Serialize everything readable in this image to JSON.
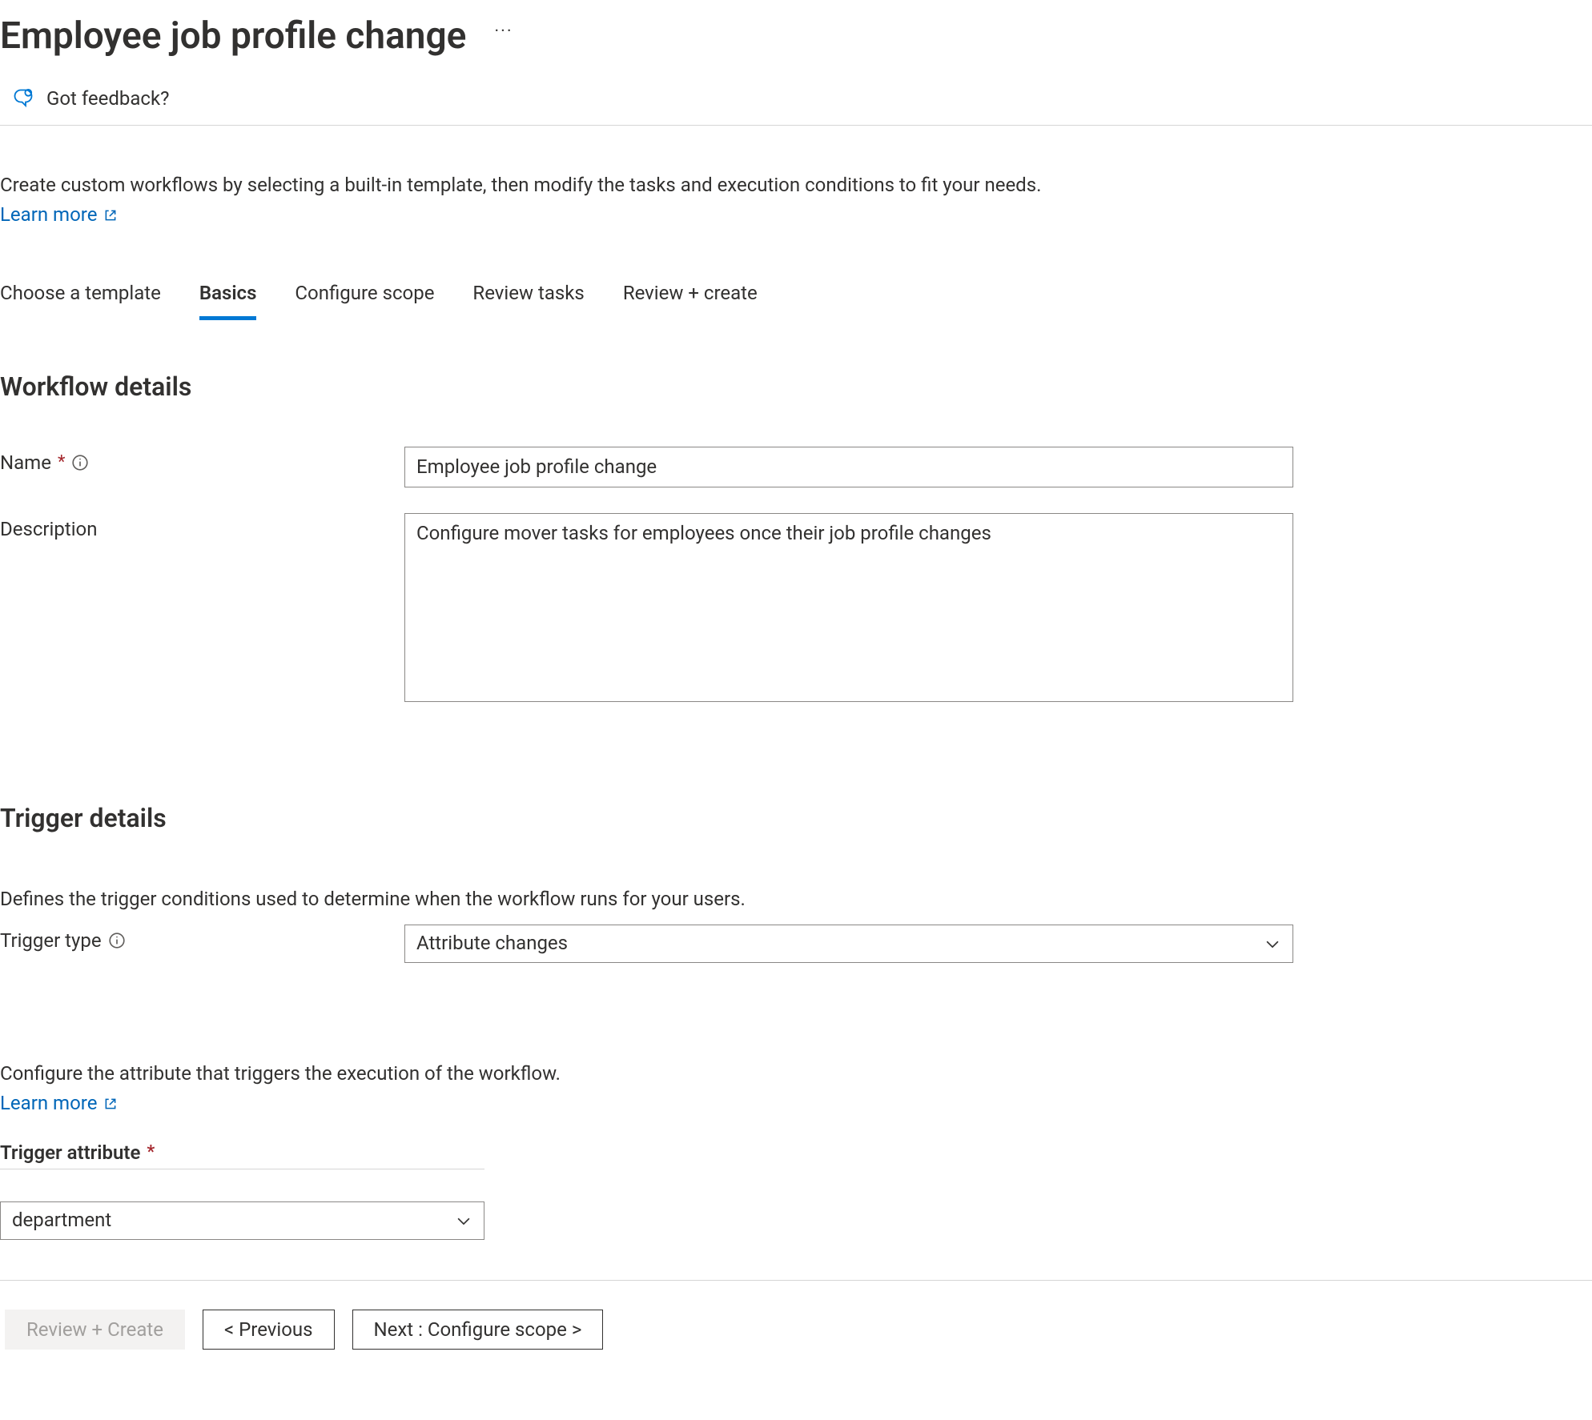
{
  "header": {
    "title": "Employee job profile change",
    "more_actions_icon": "more-horizontal-icon"
  },
  "feedback": {
    "label": "Got feedback?",
    "icon": "feedback-icon"
  },
  "intro": {
    "text": "Create custom workflows by selecting a built-in template, then modify the tasks and execution conditions to fit your needs.",
    "learn_more": "Learn more"
  },
  "tabs": [
    {
      "id": "choose-template",
      "label": "Choose a template",
      "active": false
    },
    {
      "id": "basics",
      "label": "Basics",
      "active": true
    },
    {
      "id": "configure-scope",
      "label": "Configure scope",
      "active": false
    },
    {
      "id": "review-tasks",
      "label": "Review tasks",
      "active": false
    },
    {
      "id": "review-create",
      "label": "Review + create",
      "active": false
    }
  ],
  "workflow_details": {
    "heading": "Workflow details",
    "name_label": "Name",
    "name_value": "Employee job profile change",
    "description_label": "Description",
    "description_value": "Configure mover tasks for employees once their job profile changes"
  },
  "trigger_details": {
    "heading": "Trigger details",
    "description": "Defines the trigger conditions used to determine when the workflow runs for your users.",
    "type_label": "Trigger type",
    "type_value": "Attribute changes",
    "attribute_description": "Configure the attribute that triggers the execution of the workflow.",
    "learn_more": "Learn more",
    "attribute_label": "Trigger attribute",
    "attribute_value": "department"
  },
  "footer": {
    "review_create": "Review + Create",
    "previous": "< Previous",
    "next": "Next : Configure scope >"
  }
}
